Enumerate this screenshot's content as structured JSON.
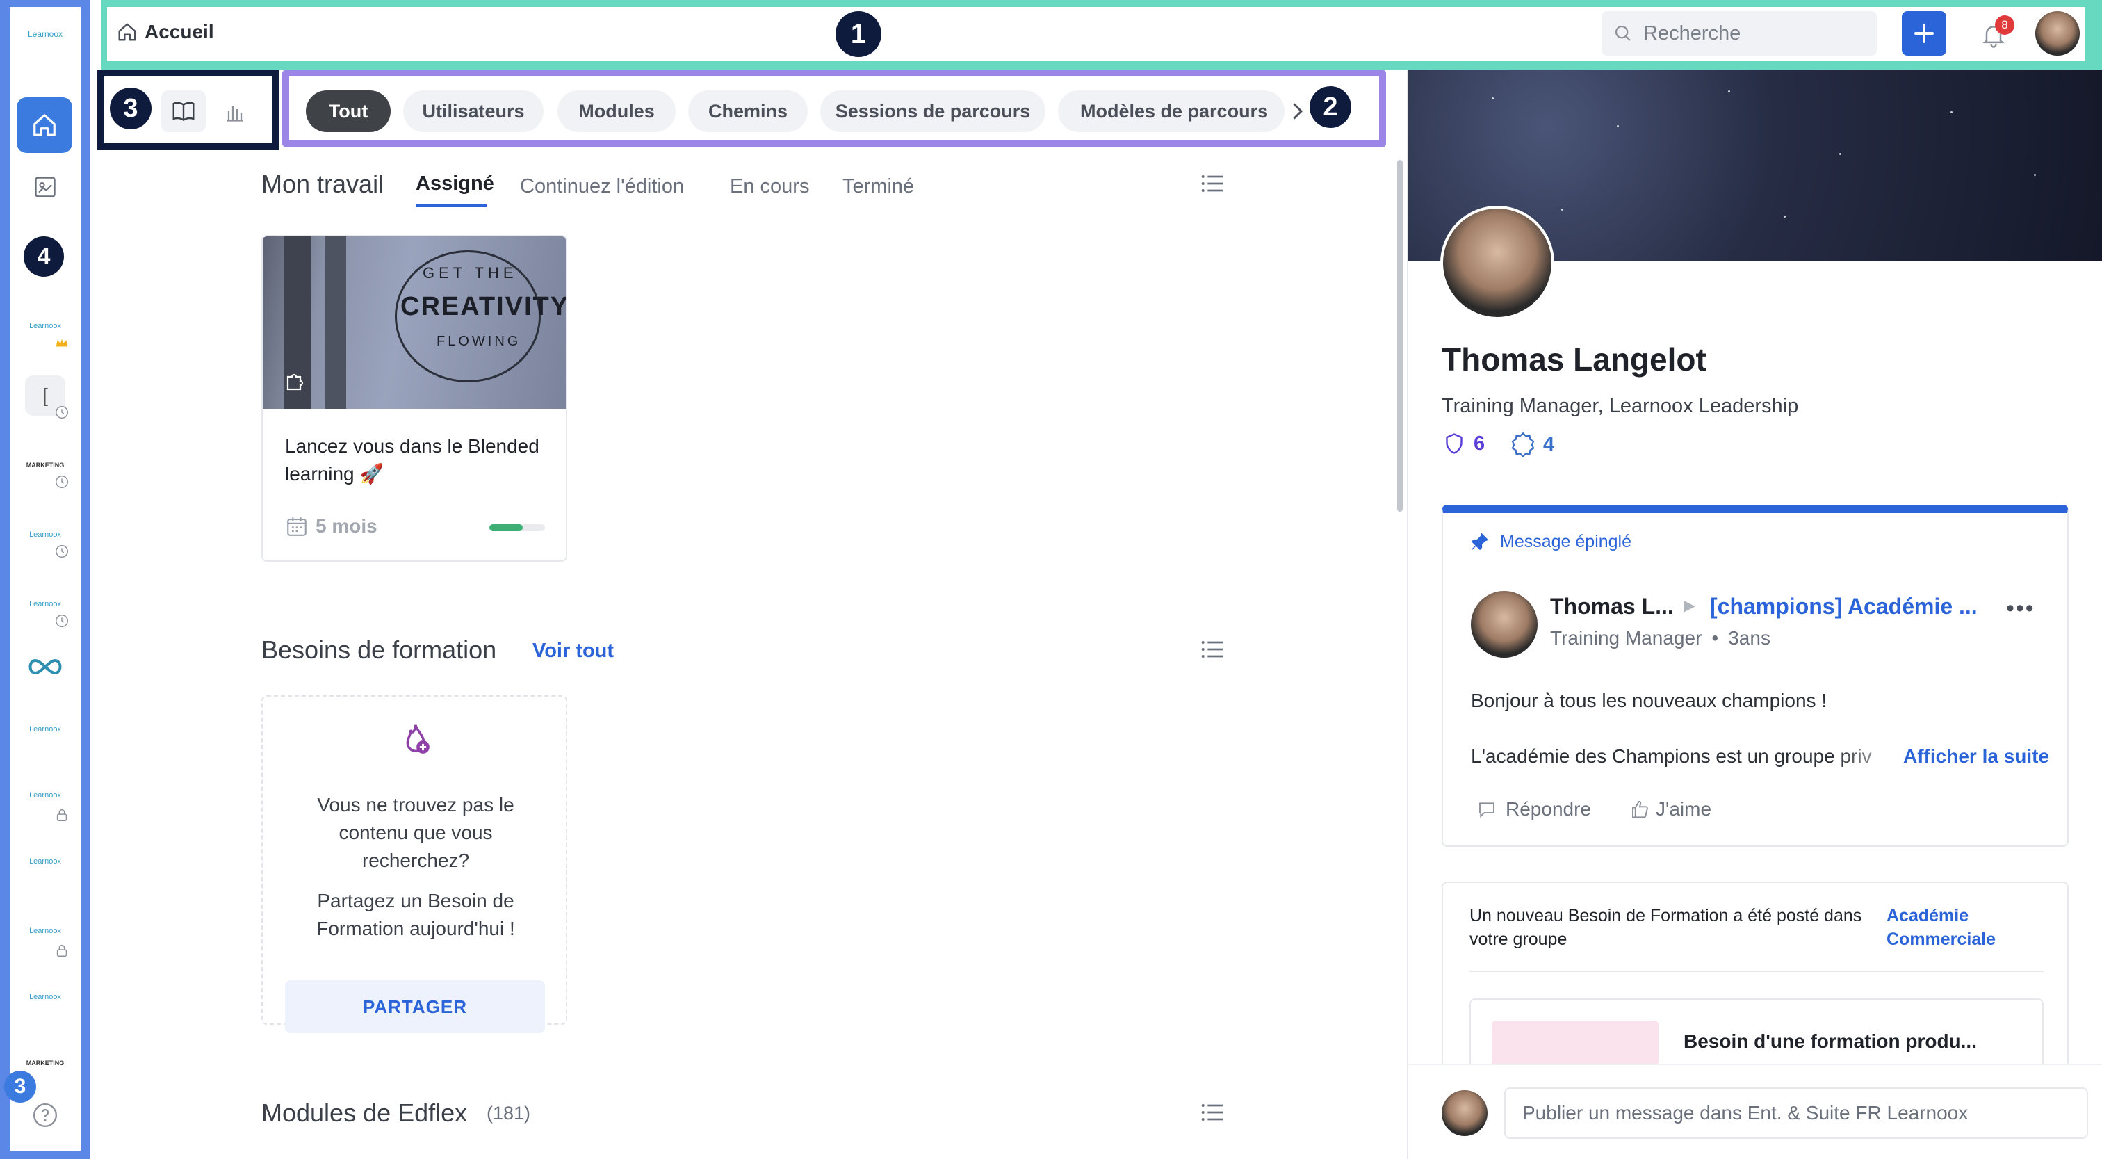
{
  "header": {
    "breadcrumb": "Accueil",
    "search_placeholder": "Recherche",
    "notif_count": "8"
  },
  "callouts": {
    "one": "1",
    "two": "2",
    "three": "3",
    "four": "4",
    "three_bottom": "3"
  },
  "sidebar": {
    "logo": "Learnoox",
    "items": [
      {
        "label": "Learnoox"
      },
      {
        "label": "["
      },
      {
        "label": "MARKETING"
      },
      {
        "label": "Learnoox"
      },
      {
        "label": "Learnoox"
      },
      {
        "label": "Learnoox"
      },
      {
        "label": "Learnoox"
      },
      {
        "label": "Learnoox"
      },
      {
        "label": "Learnoox"
      },
      {
        "label": "Learnoox"
      },
      {
        "label": "MARKETING"
      }
    ]
  },
  "filters": [
    "Tout",
    "Utilisateurs",
    "Modules",
    "Chemins",
    "Sessions de parcours",
    "Modèles de parcours"
  ],
  "my_work": {
    "title": "Mon travail",
    "tabs": [
      "Assigné",
      "Continuez l'édition",
      "En cours",
      "Terminé"
    ],
    "card": {
      "image_text_top": "GET THE",
      "image_text_main": "CREATIVITY",
      "image_text_bottom": "FLOWING",
      "title": "Lancez vous dans le Blended learning 🚀",
      "duration": "5 mois",
      "progress": 0.6
    }
  },
  "needs": {
    "title": "Besoins de formation",
    "see_all": "Voir tout",
    "text1": "Vous ne trouvez pas le contenu que vous recherchez?",
    "text2": "Partagez un Besoin de Formation aujourd'hui !",
    "button": "PARTAGER"
  },
  "edflex": {
    "title": "Modules de Edflex",
    "count": "(181)"
  },
  "profile": {
    "name": "Thomas Langelot",
    "role": "Training Manager, Learnoox Leadership",
    "stat1": "6",
    "stat2": "4"
  },
  "pinned": {
    "label": "Message épinglé",
    "author": "Thomas L...",
    "group": "[champions] Académie ...",
    "author_role": "Training Manager",
    "time": "3ans",
    "line1": "Bonjour à tous les nouveaux champions !",
    "line2": "L'académie des Champions est un groupe priv",
    "more": "Afficher la suite",
    "reply": "Répondre",
    "like": "J'aime"
  },
  "notice": {
    "text": "Un nouveau Besoin de Formation a été posté dans votre groupe",
    "group": "Académie Commerciale",
    "sub_title": "Besoin d'une formation produ..."
  },
  "composer": {
    "placeholder": "Publier un message dans Ent. & Suite FR Learnoox"
  },
  "colors": {
    "primary": "#2b64d8",
    "sidebar_frame": "#5b87e6",
    "header_frame": "#67d9c1",
    "tabs_frame": "#9b86e8",
    "callout": "#0f1b3d"
  }
}
